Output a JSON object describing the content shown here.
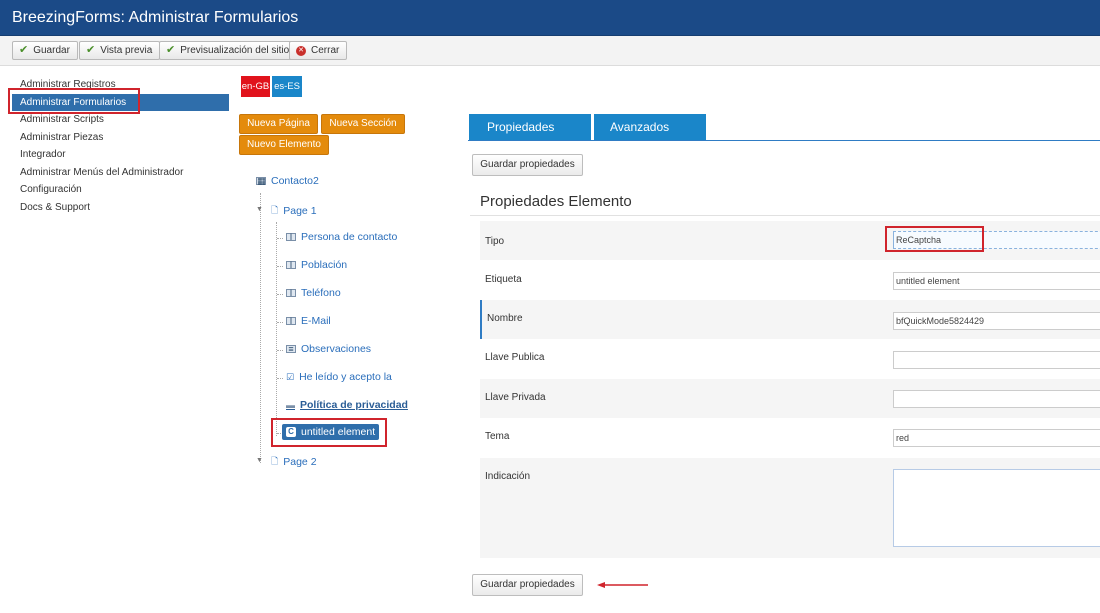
{
  "header": {
    "title": "BreezingForms: Administrar Formularios"
  },
  "toolbar": {
    "buttons": [
      {
        "label": "Guardar"
      },
      {
        "label": "Vista previa"
      },
      {
        "label": "Previsualización del sitio"
      },
      {
        "label": "Cerrar"
      }
    ]
  },
  "sidebar": {
    "items": [
      {
        "label": "Administrar Registros"
      },
      {
        "label": "Administrar Formularios"
      },
      {
        "label": "Administrar Scripts"
      },
      {
        "label": "Administrar Piezas"
      },
      {
        "label": "Integrador"
      },
      {
        "label": "Administrar Menús del Administrador"
      },
      {
        "label": "Configuración"
      },
      {
        "label": "Docs & Support"
      }
    ]
  },
  "languages": [
    "en-GB",
    "es-ES"
  ],
  "builder_buttons": {
    "new_page": "Nueva Página",
    "new_section": "Nueva Sección",
    "new_element": "Nuevo Elemento"
  },
  "tree": {
    "form": "Contacto2",
    "page1": "Page 1",
    "elements": [
      "Persona de contacto",
      "Población",
      "Teléfono",
      "E-Mail",
      "Observaciones",
      "He leído y acepto la"
    ],
    "section": "Política de privacidad",
    "selected": "untitled element",
    "page2": "Page 2"
  },
  "tabs": {
    "properties": "Propiedades",
    "advanced": "Avanzados"
  },
  "save_properties": "Guardar propiedades",
  "section_title": "Propiedades Elemento",
  "properties": {
    "tipo": {
      "label": "Tipo",
      "value": "ReCaptcha"
    },
    "etiqueta": {
      "label": "Etiqueta",
      "value": "untitled element"
    },
    "nombre": {
      "label": "Nombre",
      "value": "bfQuickMode5824429"
    },
    "llave_publica": {
      "label": "Llave Publica",
      "value": ""
    },
    "llave_privada": {
      "label": "Llave Privada",
      "value": ""
    },
    "tema": {
      "label": "Tema",
      "value": "red"
    },
    "indicacion": {
      "label": "Indicación",
      "value": ""
    }
  },
  "colors": {
    "header": "#1b4a87",
    "accent": "#2f6eab",
    "tab": "#1a86c9",
    "orange": "#e48b0c",
    "lang_en": "#e1131c",
    "lang_es": "#1a86c9",
    "highlight": "#d0242c"
  }
}
